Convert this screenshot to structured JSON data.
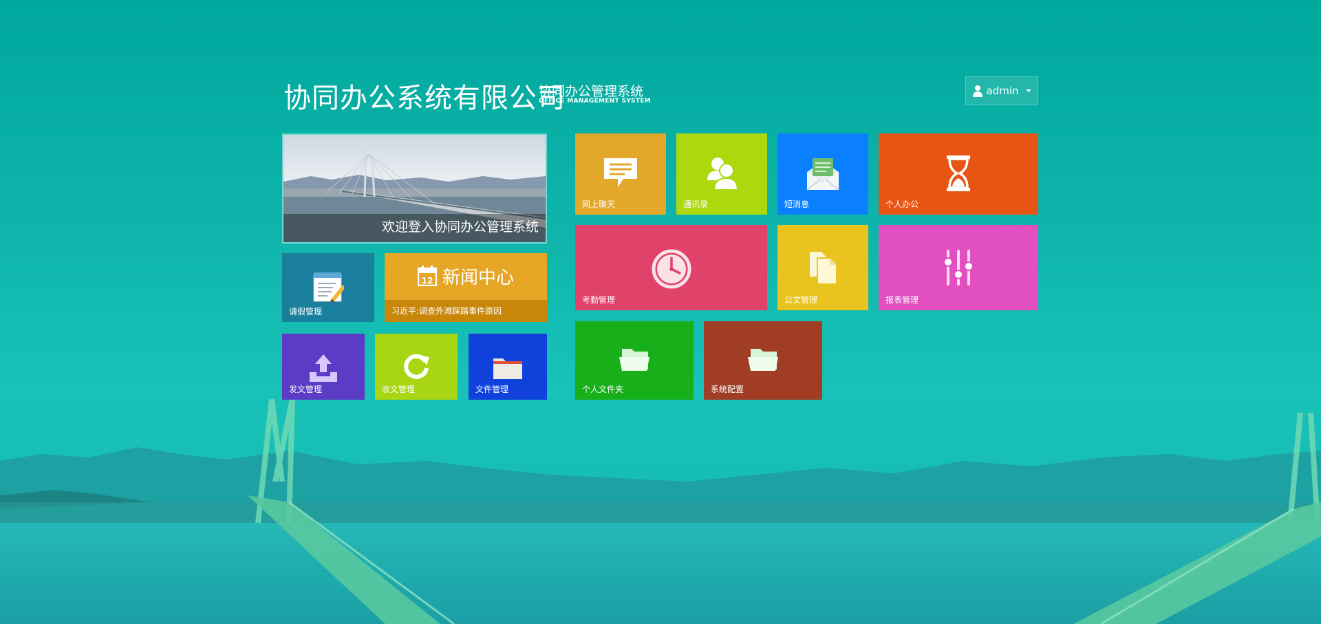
{
  "header": {
    "company": "协同办公系统有限公司",
    "system_cn": "协同办公管理系统",
    "system_en": "OFFICE MANAGEMENT SYSTEM"
  },
  "user": {
    "name": "admin"
  },
  "banner": {
    "caption": "欢迎登入协同办公管理系统"
  },
  "news": {
    "title": "新闻中心",
    "calendar_day": "12",
    "headline": "习近平:调查外滩踩踏事件原因"
  },
  "tiles": {
    "leave": "请假管理",
    "send_doc": "发文管理",
    "receive_doc": "收文管理",
    "file": "文件管理",
    "chat": "网上聊天",
    "contacts": "通讯录",
    "sms": "短消息",
    "personal_office": "个人办公",
    "attendance": "考勤管理",
    "official_doc": "公文管理",
    "report": "报表管理",
    "personal_folder": "个人文件夹",
    "system_config": "系统配置"
  },
  "colors": {
    "background": "#00a79c",
    "leave": "#1a7f9c",
    "news": "#e6a626",
    "send_doc": "#5b3cc4",
    "receive_doc": "#a8d612",
    "file": "#1141db",
    "chat": "#e3a72a",
    "contacts": "#aed80e",
    "sms": "#0a7fff",
    "personal_office": "#e75514",
    "attendance": "#e0436a",
    "official_doc": "#e9c41f",
    "report": "#e14fc0",
    "personal_folder": "#18b01a",
    "system_config": "#a13d25"
  },
  "icons": {
    "user": "user-icon",
    "leave": "notepad-pencil-icon",
    "news": "calendar-icon",
    "send_doc": "upload-tray-icon",
    "receive_doc": "refresh-icon",
    "file": "folder-icon",
    "chat": "chat-bubble-icon",
    "contacts": "people-icon",
    "sms": "envelope-icon",
    "personal_office": "hourglass-icon",
    "attendance": "clock-icon",
    "official_doc": "documents-icon",
    "report": "sliders-icon",
    "personal_folder": "folder-open-icon",
    "system_config": "folder-open-icon"
  }
}
